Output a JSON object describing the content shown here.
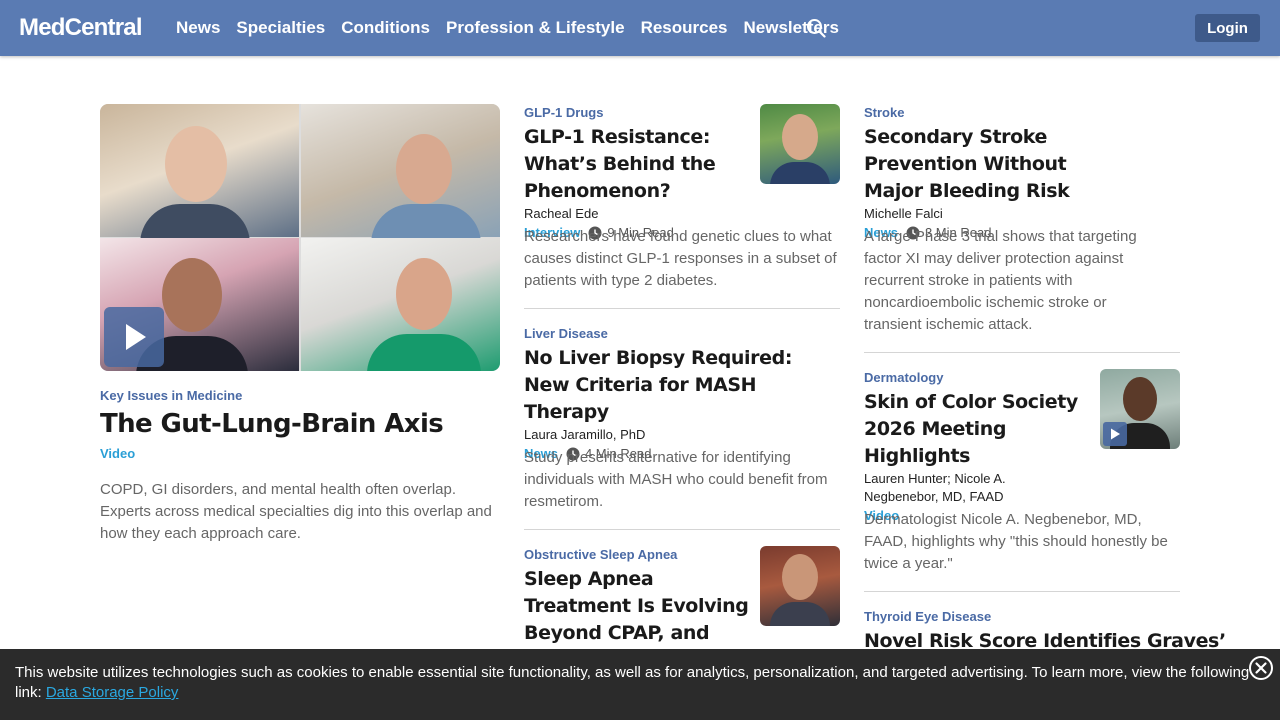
{
  "nav": {
    "logo": "MedCentral",
    "links": [
      "News",
      "Specialties",
      "Conditions",
      "Profession & Lifestyle",
      "Resources",
      "Newsletters"
    ],
    "login": "Login"
  },
  "hero": {
    "category": "Key Issues in Medicine",
    "title": "The Gut-Lung-Brain Axis",
    "type": "Video",
    "description": "COPD, GI disorders, and mental health often overlap. Experts across medical specialties dig into this overlap and how they each approach care."
  },
  "col2": [
    {
      "category": "GLP-1 Drugs",
      "title": "GLP-1 Resistance: What’s Behind the Phenomenon?",
      "author": "Racheal Ede",
      "type": "Interview",
      "read": "9 Min Read",
      "description": "Researchers have found genetic clues to what causes distinct GLP-1 responses in a subset of patients with type 2 diabetes."
    },
    {
      "category": "Liver Disease",
      "title": "No Liver Biopsy Required: New Criteria for MASH Therapy",
      "author": "Laura Jaramillo, PhD",
      "type": "News",
      "read": "4 Min Read",
      "description": "Study presents alternative for identifying individuals with MASH who could benefit from resmetirom."
    },
    {
      "category": "Obstructive Sleep Apnea",
      "title": "Sleep Apnea Treatment Is Evolving Beyond CPAP, and That’s a Good Thing"
    }
  ],
  "col3": [
    {
      "category": "Stroke",
      "title": "Secondary Stroke Prevention Without Major Bleeding Risk",
      "author": "Michelle Falci",
      "type": "News",
      "read": "3 Min Read",
      "description": "A large Phase 3 trial shows that targeting factor XI may deliver protection against recurrent stroke in patients with noncardioembolic ischemic stroke or transient ischemic attack."
    },
    {
      "category": "Dermatology",
      "title": "Skin of Color Society 2026 Meeting Highlights",
      "author": "Lauren Hunter; Nicole A. Negbenebor, MD, FAAD",
      "type": "Video",
      "description": "Dermatologist Nicole A. Negbenebor, MD, FAAD, highlights why \"this should honestly be twice a year.\""
    },
    {
      "category": "Thyroid Eye Disease",
      "title": "Novel Risk Score Identifies Graves’"
    }
  ],
  "cookie": {
    "text": "This website utilizes technologies such as cookies to enable essential site functionality, as well as for analytics, personalization, and targeted advertising. To learn more, view the following link: ",
    "link": "Data Storage Policy"
  },
  "icons": {
    "search": "search-icon",
    "clock": "clock-icon",
    "play": "play-icon",
    "close": "close-icon"
  },
  "colors": {
    "nav_bg": "#5a7bb3",
    "login_bg": "#3e5a8a",
    "category": "#4a6aa5",
    "type_link": "#2a9fd6",
    "cookie_bg": "#2b2b2b"
  }
}
